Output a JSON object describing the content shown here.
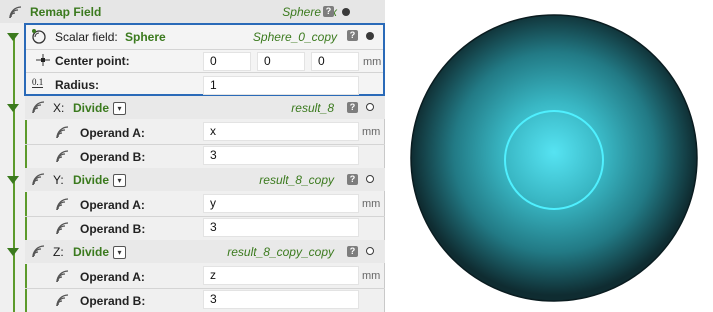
{
  "remap": {
    "title": "Remap Field",
    "result": "Sphere 3x"
  },
  "scalar": {
    "label": "Scalar field:",
    "type": "Sphere",
    "result": "Sphere_0_copy",
    "center_label": "Center point:",
    "center": [
      "0",
      "0",
      "0"
    ],
    "center_unit": "mm",
    "radius_label": "Radius:",
    "radius": "1",
    "radius_icon": "0.1"
  },
  "divides": [
    {
      "axis": "X:",
      "op": "Divide",
      "result": "result_8",
      "a_label": "Operand A:",
      "a": "x",
      "a_unit": "mm",
      "b_label": "Operand B:",
      "b": "3"
    },
    {
      "axis": "Y:",
      "op": "Divide",
      "result": "result_8_copy",
      "a_label": "Operand A:",
      "a": "y",
      "a_unit": "mm",
      "b_label": "Operand B:",
      "b": "3"
    },
    {
      "axis": "Z:",
      "op": "Divide",
      "result": "result_8_copy_copy",
      "a_label": "Operand A:",
      "a": "z",
      "a_unit": "mm",
      "b_label": "Operand B:",
      "b": "3"
    }
  ],
  "help_glyph": "?",
  "dropdown_glyph": "▾",
  "icons": {
    "field": "field-waves-icon",
    "sphere": "sphere-icon",
    "point": "crosshair-icon"
  },
  "colors": {
    "accent_green": "#3b7a1e",
    "selection_border": "#2a6ab8",
    "sphere_outer": "#0f2c31",
    "sphere_inner": "#56e3f2"
  }
}
